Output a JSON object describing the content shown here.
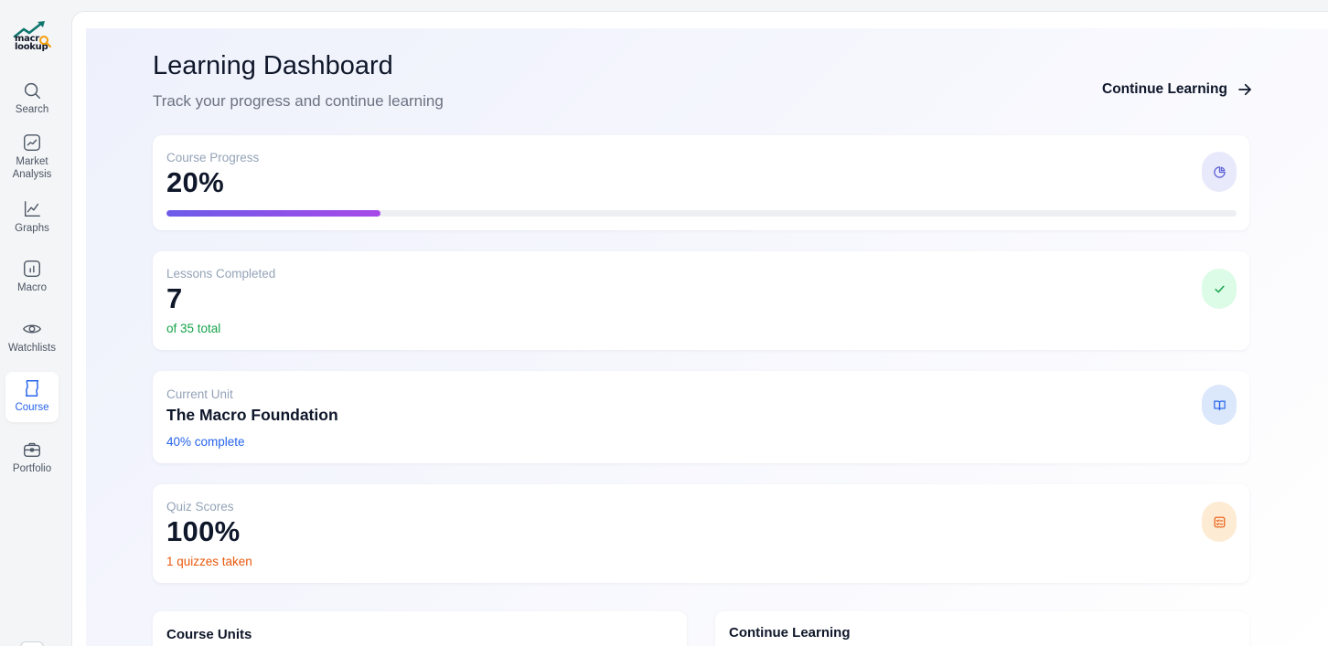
{
  "sidebar": {
    "logo_text_line1": "macr",
    "logo_text_line2": "lookup",
    "items": [
      {
        "label": "Search",
        "icon": "search-icon",
        "active": false
      },
      {
        "label": "Market Analysis",
        "icon": "trend-chart-icon",
        "active": false
      },
      {
        "label": "Graphs",
        "icon": "line-graph-icon",
        "active": false
      },
      {
        "label": "Macro",
        "icon": "bar-chart-icon",
        "active": false
      },
      {
        "label": "Watchlists",
        "icon": "eye-icon",
        "active": false
      },
      {
        "label": "Course",
        "icon": "scroll-icon",
        "active": true
      },
      {
        "label": "Portfolio",
        "icon": "briefcase-icon",
        "active": false
      }
    ]
  },
  "header": {
    "title": "Learning Dashboard",
    "subtitle": "Track your progress and continue learning",
    "continue_label": "Continue Learning"
  },
  "cards": {
    "progress": {
      "label": "Course Progress",
      "value": "20%",
      "fraction": 0.2
    },
    "lessons": {
      "label": "Lessons Completed",
      "value": "7",
      "sub": "of 35 total"
    },
    "unit": {
      "label": "Current Unit",
      "value": "The Macro Foundation",
      "sub": "40% complete"
    },
    "quiz": {
      "label": "Quiz Scores",
      "value": "100%",
      "sub": "1 quizzes taken"
    }
  },
  "bottom": {
    "units_title": "Course Units",
    "continue_title": "Continue Learning"
  },
  "colors": {
    "accent_blue": "#2563eb",
    "green": "#16a34a",
    "orange": "#ea580c",
    "purple_badge_bg": "#e8e9fb",
    "green_badge_bg": "#dcfce7",
    "blue_badge_bg": "#dbe7fb",
    "orange_badge_bg": "#fdebd3"
  }
}
